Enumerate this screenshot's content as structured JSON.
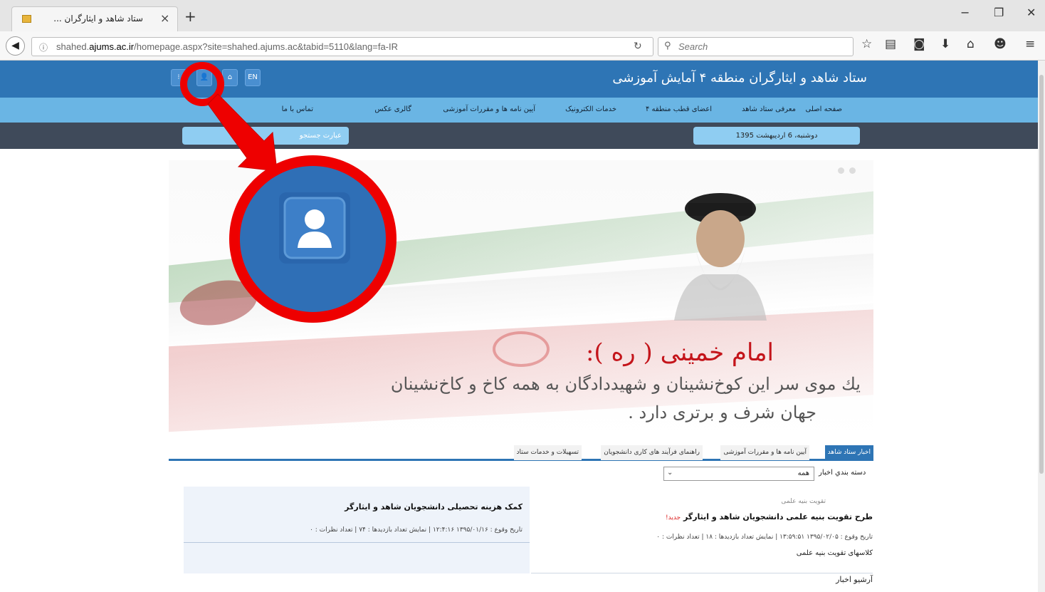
{
  "browser": {
    "tab_title": "ستاد شاهد و ایثارگران ...",
    "tab_close": "×",
    "new_tab": "+",
    "url_prefix": "shahed.",
    "url_domain": "ajums.ac.ir",
    "url_path": "/homepage.aspx?site=shahed.ajums.ac&tabid=5110&lang=fa-IR",
    "search_placeholder": "Search",
    "win_min": "−",
    "win_max": "❐",
    "win_close": "✕"
  },
  "site": {
    "title": "ستاد شاهد و ایثارگران منطقه ۴ آمایش آموزشی",
    "lang_button": "EN",
    "search_box": "عبارت جستجو",
    "date": "دوشنبه، 6 اردیبهشت 1395",
    "menu": [
      "صفحه اصلی",
      "معرفی ستاد شاهد",
      "اعضای قطب منطقه ۴",
      "خدمات الکترونیک",
      "آیین نامه ها و مقررات آموزشی",
      "گالری عکس",
      "تماس با ما"
    ]
  },
  "banner": {
    "heading": "امام خمینی ( ره ):",
    "line1": "یك موی سر این کوخ‌نشینان و شهیدداد‌گان به همه کاخ و کاخ‌نشینان",
    "line2": "جهان شرف و برتری دارد ."
  },
  "news_tabs": [
    "اخبار ستاد شاهد",
    "آیین نامه ها و مقررات آموزشی",
    "راهنمای فرآیند های کاری دانشجویان",
    "تسهیلات و خدمات ستاد"
  ],
  "category": {
    "label": "دسته بندي اخبار",
    "value": "همه"
  },
  "news_right": {
    "category": "تقویت بنیه علمی",
    "title": "طرح تقویت بنیه علمی دانشجویان شاهد و ایثارگر",
    "new_tag": "جدید!",
    "meta": "تاریخ وقوع : ۱۳۹۵/۰۲/۰۵  ۱۳:۵۹:۵۱ | نمایش تعداد بازدیدها : ۱۸ | تعداد نظرات : ۰",
    "summary": "کلاسهای تقویت بنیه علمی",
    "archive": "آرشیو اخبار"
  },
  "news_left": {
    "title": "کمک هزینه تحصیلی دانشجویان شاهد و ایثارگر",
    "meta": "تاریخ وقوع : ۱۳۹۵/۰۱/۱۶  ۱۲:۴:۱۶ | نمایش تعداد بازدیدها : ۷۴ | تعداد نظرات : ۰"
  },
  "colors": {
    "header": "#2e75b5",
    "menu": "#6ab5e4",
    "annotation": "#ee0000"
  }
}
